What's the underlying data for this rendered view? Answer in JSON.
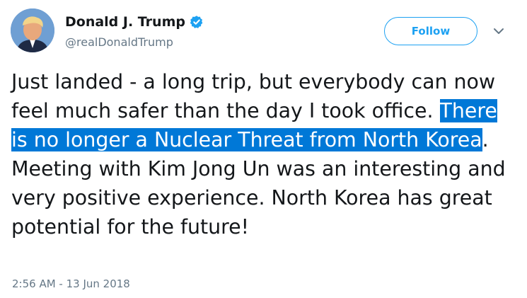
{
  "author": {
    "display_name": "Donald J. Trump",
    "handle": "@realDonaldTrump",
    "verified": true
  },
  "follow_button": {
    "label": "Follow"
  },
  "icons": {
    "verified": "verified-badge-icon",
    "menu": "chevron-down-icon"
  },
  "tweet": {
    "segments": [
      {
        "text": "Just landed - a long trip, but everybody can now feel much safer than the day I took office. ",
        "highlighted": false
      },
      {
        "text": "There is no longer a Nuclear Threat from North Korea",
        "highlighted": true
      },
      {
        "text": ". Meeting with Kim Jong Un was an interesting and very positive experience. North Korea has great potential for the future!",
        "highlighted": false
      }
    ],
    "timestamp": "2:56 AM - 13 Jun 2018"
  },
  "colors": {
    "accent": "#1da1f2",
    "selection": "#0078d7",
    "text": "#14171a",
    "muted": "#657786"
  }
}
